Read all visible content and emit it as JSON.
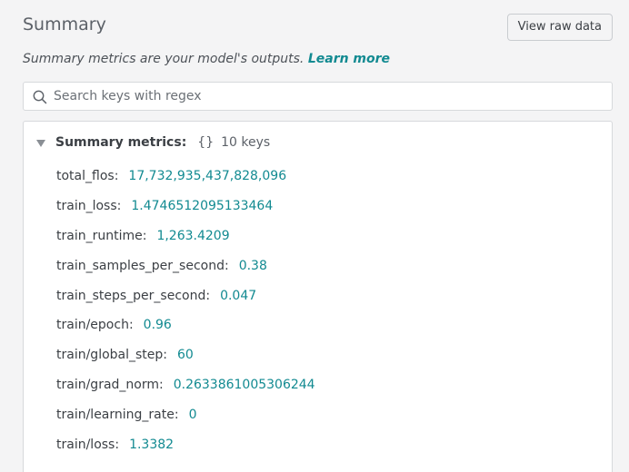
{
  "header": {
    "title": "Summary",
    "view_raw_label": "View raw data"
  },
  "intro": {
    "text": "Summary metrics are your model's outputs.",
    "link_label": "Learn more"
  },
  "search": {
    "placeholder": "Search keys with regex",
    "value": ""
  },
  "group": {
    "name": "Summary metrics:",
    "type_icon": "{}",
    "count": "10 keys",
    "expanded": true
  },
  "metrics": [
    {
      "key": "total_flos:",
      "value": "17,732,935,437,828,096"
    },
    {
      "key": "train_loss:",
      "value": "1.4746512095133464"
    },
    {
      "key": "train_runtime:",
      "value": "1,263.4209"
    },
    {
      "key": "train_samples_per_second:",
      "value": "0.38"
    },
    {
      "key": "train_steps_per_second:",
      "value": "0.047"
    },
    {
      "key": "train/epoch:",
      "value": "0.96"
    },
    {
      "key": "train/global_step:",
      "value": "60"
    },
    {
      "key": "train/grad_norm:",
      "value": "0.2633861005306244"
    },
    {
      "key": "train/learning_rate:",
      "value": "0"
    },
    {
      "key": "train/loss:",
      "value": "1.3382"
    }
  ],
  "colors": {
    "accent": "#128a91",
    "background": "#f4f4f5",
    "panel": "#ffffff"
  },
  "icons": {
    "search": "search-icon",
    "toggle": "caret-down-icon"
  }
}
